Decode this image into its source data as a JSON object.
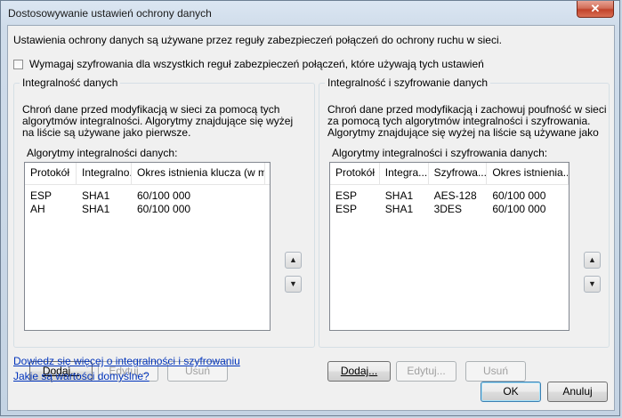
{
  "window": {
    "title": "Dostosowywanie ustawień ochrony danych",
    "close_label": "✕"
  },
  "intro_text": "Ustawienia ochrony danych są używane przez reguły zabezpieczeń połączeń do ochrony ruchu w sieci.",
  "require_encryption": {
    "label": "Wymagaj szyfrowania dla wszystkich reguł zabezpieczeń połączeń, które używają tych ustawień",
    "checked": false
  },
  "integrity": {
    "title": "Integralność danych",
    "description": "Chroń dane przed modyfikacją w sieci za pomocą tych algorytmów integralności. Algorytmy znajdujące się wyżej na liście są używane jako pierwsze.",
    "list_label": "Algorytmy integralności danych:",
    "columns": [
      "Protokół",
      "Integralno...",
      "Okres istnienia klucza (w m..."
    ],
    "rows": [
      [
        "ESP",
        "SHA1",
        "60/100 000"
      ],
      [
        "AH",
        "SHA1",
        "60/100 000"
      ]
    ],
    "buttons": {
      "add": "Dodaj...",
      "edit": "Edytuj...",
      "remove": "Usuń"
    }
  },
  "integrity_encryption": {
    "title": "Integralność i szyfrowanie danych",
    "description": "Chroń dane przed modyfikacją i zachowuj poufność w sieci za pomocą tych algorytmów integralności i szyfrowania. Algorytmy znajdujące się wyżej na liście są używane jako",
    "list_label": "Algorytmy integralności i szyfrowania danych:",
    "columns": [
      "Protokół",
      "Integra...",
      "Szyfrowa...",
      "Okres istnienia..."
    ],
    "rows": [
      [
        "ESP",
        "SHA1",
        "AES-128",
        "60/100 000"
      ],
      [
        "ESP",
        "SHA1",
        "3DES",
        "60/100 000"
      ]
    ],
    "buttons": {
      "add": "Dodaj...",
      "edit": "Edytuj...",
      "remove": "Usuń"
    }
  },
  "move_up_label": "▲",
  "move_down_label": "▼",
  "links": {
    "learn_more": "Dowiedz się więcej o integralności i szyfrowaniu",
    "defaults": "Jakie są wartości domyślne?"
  },
  "footer": {
    "ok": "OK",
    "cancel": "Anuluj"
  }
}
